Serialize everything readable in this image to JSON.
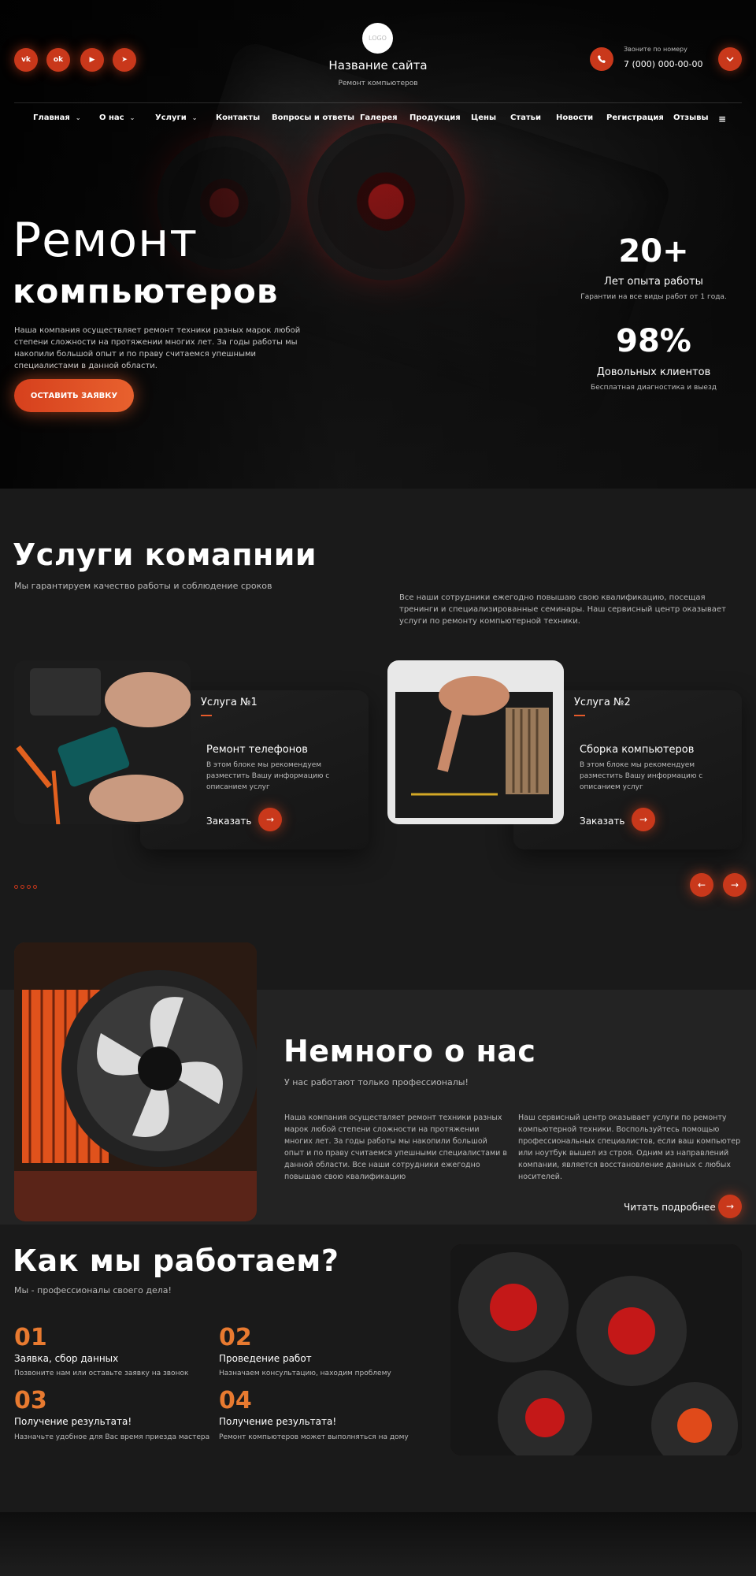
{
  "header": {
    "social": [
      {
        "label": "vk",
        "icon": "vk-icon"
      },
      {
        "label": "ok",
        "icon": "odnoklassniki-icon"
      },
      {
        "label": "▶",
        "icon": "youtube-icon"
      },
      {
        "label": "➤",
        "icon": "telegram-icon"
      }
    ],
    "logo_text": "LOGO",
    "site_name": "Название сайта",
    "site_subtitle": "Ремонт компьютеров",
    "call_label": "Звоните по номеру",
    "phone": "7 (000) 000-00-00"
  },
  "nav": {
    "items": [
      {
        "label": "Главная",
        "dropdown": true
      },
      {
        "label": "О нас",
        "dropdown": true
      },
      {
        "label": "Услуги",
        "dropdown": true
      },
      {
        "label": "Контакты",
        "dropdown": false
      },
      {
        "label": "Вопросы и ответы",
        "dropdown": false
      },
      {
        "label": "Галерея",
        "dropdown": false
      },
      {
        "label": "Продукция",
        "dropdown": false
      },
      {
        "label": "Цены",
        "dropdown": false
      },
      {
        "label": "Статьи",
        "dropdown": false
      },
      {
        "label": "Новости",
        "dropdown": false
      },
      {
        "label": "Регистрация",
        "dropdown": false
      },
      {
        "label": "Отзывы",
        "dropdown": false
      }
    ]
  },
  "hero": {
    "title_line1": "Ремонт",
    "title_line2": "компьютеров",
    "description": "Наша компания осуществляет ремонт техники разных марок любой степени сложности на протяжении многих лет. За годы работы мы накопили большой опыт и по праву считаемся упешными специалистами в данной области.",
    "cta_label": "ОСТАВИТЬ ЗАЯВКУ",
    "stats": [
      {
        "value": "20+",
        "label": "Лет опыта работы",
        "sub": "Гарантии на все виды работ от 1 года."
      },
      {
        "value": "98%",
        "label": "Довольных клиентов",
        "sub": "Бесплатная диагностика и выезд"
      }
    ]
  },
  "services": {
    "title": "Услуги комапнии",
    "subtitle": "Мы гарантируем качество работы и соблюдение сроков",
    "description": "Все наши сотрудники ежегодно повышаю свою квалификацию, посещая тренинги и специализированные семинары. Наш сервисный центр оказывает услуги по ремонту компьютерной техники.",
    "cards": [
      {
        "tag": "Услуга №1",
        "title": "Ремонт телефонов",
        "text": "В этом блоке мы рекомендуем разместить Вашу информацию с описанием услуг",
        "order_label": "Заказать"
      },
      {
        "tag": "Услуга №2",
        "title": "Сборка компьютеров",
        "text": "В этом блоке мы рекомендуем разместить Вашу информацию с описанием услуг",
        "order_label": "Заказать"
      }
    ]
  },
  "about": {
    "title": "Немного о нас",
    "subtitle": "У нас работают только профессионалы!",
    "col1": "Наша компания осуществляет ремонт техники разных марок любой степени сложности на протяжении многих лет. За годы работы мы накопили большой опыт и по праву считаемся упешными специалистами в данной области. Все наши сотрудники ежегодно повышаю свою квалификацию",
    "col2": "Наш сервисный центр оказывает услуги по ремонту компьютерной техники. Воспользуйтесь помощью профессиональных специалистов, если ваш компьютер или ноутбук вышел из строя. Одним из направлений компании, является восстановление данных с любых носителей.",
    "read_more": "Читать подробнее"
  },
  "how": {
    "title": "Как мы работаем?",
    "subtitle": "Мы - профессионалы своего дела!",
    "steps": [
      {
        "num": "01",
        "title": "Заявка, сбор данных",
        "text": "Позвоните нам или оставьте заявку на звонок"
      },
      {
        "num": "02",
        "title": "Проведение работ",
        "text": "Назначаем консультацию, находим проблему"
      },
      {
        "num": "03",
        "title": "Получение результата!",
        "text": "Назначьте удобное для Вас время приезда мастера"
      },
      {
        "num": "04",
        "title": "Получение результата!",
        "text": "Ремонт компьютеров может выполняться на дому"
      }
    ]
  },
  "colors": {
    "accent": "#c9381b",
    "accent_light": "#e87a30",
    "background": "#1a1a1a"
  }
}
